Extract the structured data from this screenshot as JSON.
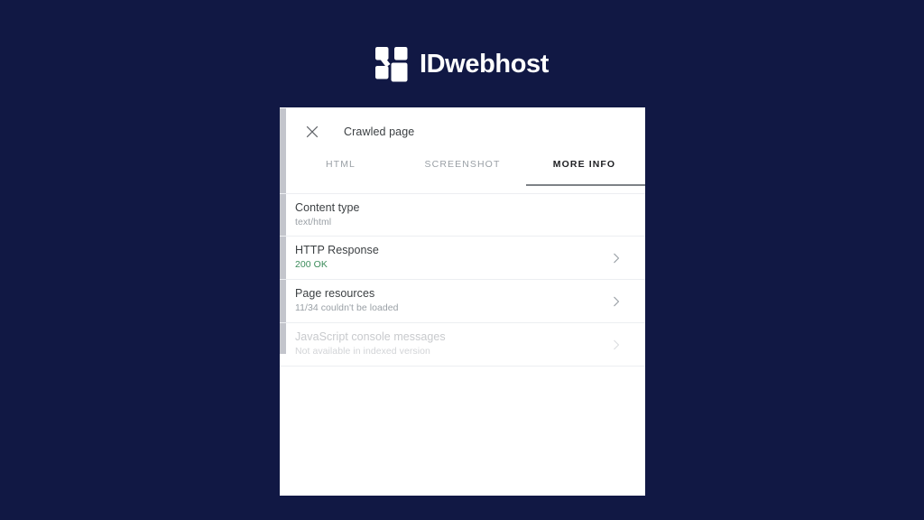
{
  "page": {
    "background_color": "#111844"
  },
  "brand": {
    "name": "IDwebhost",
    "mark_icon": "idwebhost-blocks-logo",
    "mark_color": "#ffffff"
  },
  "card": {
    "header": {
      "close_icon": "close-icon",
      "title": "Crawled page"
    },
    "tabs": [
      {
        "label": "HTML",
        "active": false
      },
      {
        "label": "SCREENSHOT",
        "active": false
      },
      {
        "label": "MORE INFO",
        "active": true
      }
    ],
    "tab_indicator_color": "#7e8287",
    "rows": [
      {
        "title": "Content type",
        "subtitle": "text/html",
        "has_chevron": false,
        "disabled": false,
        "subtitle_color": "#9aa0a6"
      },
      {
        "title": "HTTP Response",
        "subtitle": "200 OK",
        "has_chevron": true,
        "disabled": false,
        "subtitle_color": "#3c8c5b"
      },
      {
        "title": "Page resources",
        "subtitle": "11/34 couldn't be loaded",
        "has_chevron": true,
        "disabled": false,
        "subtitle_color": "#9aa0a6"
      },
      {
        "title": "JavaScript console messages",
        "subtitle": "Not available in indexed version",
        "has_chevron": true,
        "disabled": true,
        "subtitle_color": "#d2d4d7"
      }
    ]
  }
}
